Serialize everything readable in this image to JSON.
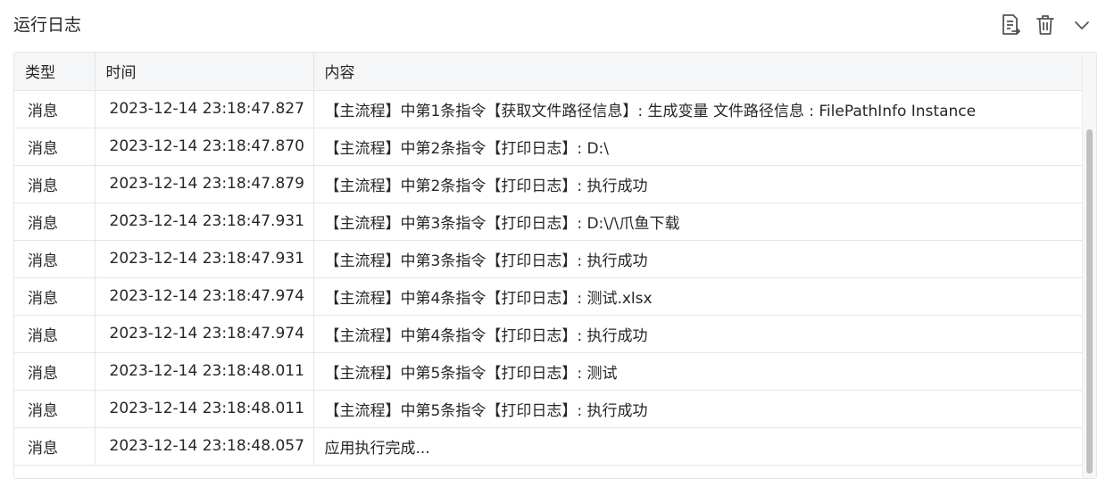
{
  "panel": {
    "title": "运行日志",
    "icons": {
      "export": "export-log-icon",
      "delete": "trash-icon",
      "collapse": "chevron-down-icon"
    }
  },
  "table": {
    "columns": [
      "类型",
      "时间",
      "内容"
    ],
    "rows": [
      {
        "type": "消息",
        "time": "2023-12-14 23:18:47.827",
        "content": "【主流程】中第1条指令【获取文件路径信息】: 生成变量 文件路径信息 : FilePathInfo Instance"
      },
      {
        "type": "消息",
        "time": "2023-12-14 23:18:47.870",
        "content": "【主流程】中第2条指令【打印日志】: D:\\"
      },
      {
        "type": "消息",
        "time": "2023-12-14 23:18:47.879",
        "content": "【主流程】中第2条指令【打印日志】: 执行成功"
      },
      {
        "type": "消息",
        "time": "2023-12-14 23:18:47.931",
        "content": "【主流程】中第3条指令【打印日志】: D:\\/\\爪鱼下载"
      },
      {
        "type": "消息",
        "time": "2023-12-14 23:18:47.931",
        "content": "【主流程】中第3条指令【打印日志】: 执行成功"
      },
      {
        "type": "消息",
        "time": "2023-12-14 23:18:47.974",
        "content": "【主流程】中第4条指令【打印日志】: 测试.xlsx"
      },
      {
        "type": "消息",
        "time": "2023-12-14 23:18:47.974",
        "content": "【主流程】中第4条指令【打印日志】: 执行成功"
      },
      {
        "type": "消息",
        "time": "2023-12-14 23:18:48.011",
        "content": "【主流程】中第5条指令【打印日志】: 测试"
      },
      {
        "type": "消息",
        "time": "2023-12-14 23:18:48.011",
        "content": "【主流程】中第5条指令【打印日志】: 执行成功"
      },
      {
        "type": "消息",
        "time": "2023-12-14 23:18:48.057",
        "content": "应用执行完成..."
      }
    ]
  }
}
